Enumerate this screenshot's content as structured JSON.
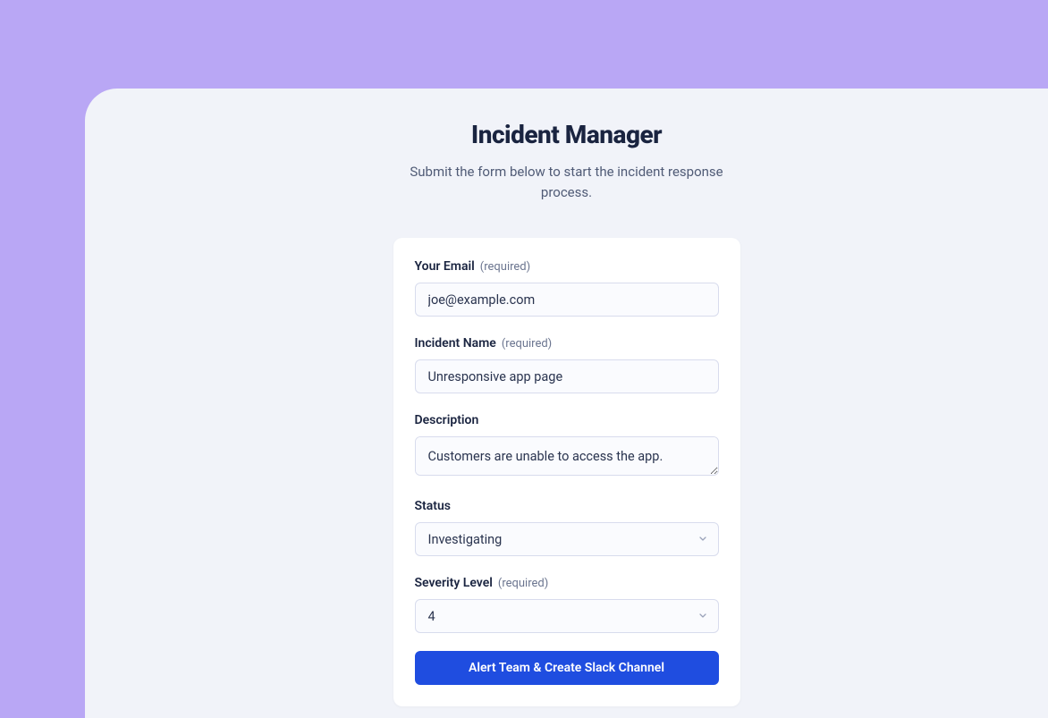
{
  "header": {
    "title": "Incident Manager",
    "subtitle": "Submit the form below to start the incident response process."
  },
  "form": {
    "email": {
      "label": "Your Email",
      "required_text": "(required)",
      "value": "joe@example.com"
    },
    "incident_name": {
      "label": "Incident Name",
      "required_text": "(required)",
      "value": "Unresponsive app page"
    },
    "description": {
      "label": "Description",
      "value": "Customers are unable to access the app."
    },
    "status": {
      "label": "Status",
      "value": "Investigating"
    },
    "severity": {
      "label": "Severity Level",
      "required_text": "(required)",
      "value": "4"
    },
    "submit_label": "Alert Team & Create Slack Channel"
  }
}
